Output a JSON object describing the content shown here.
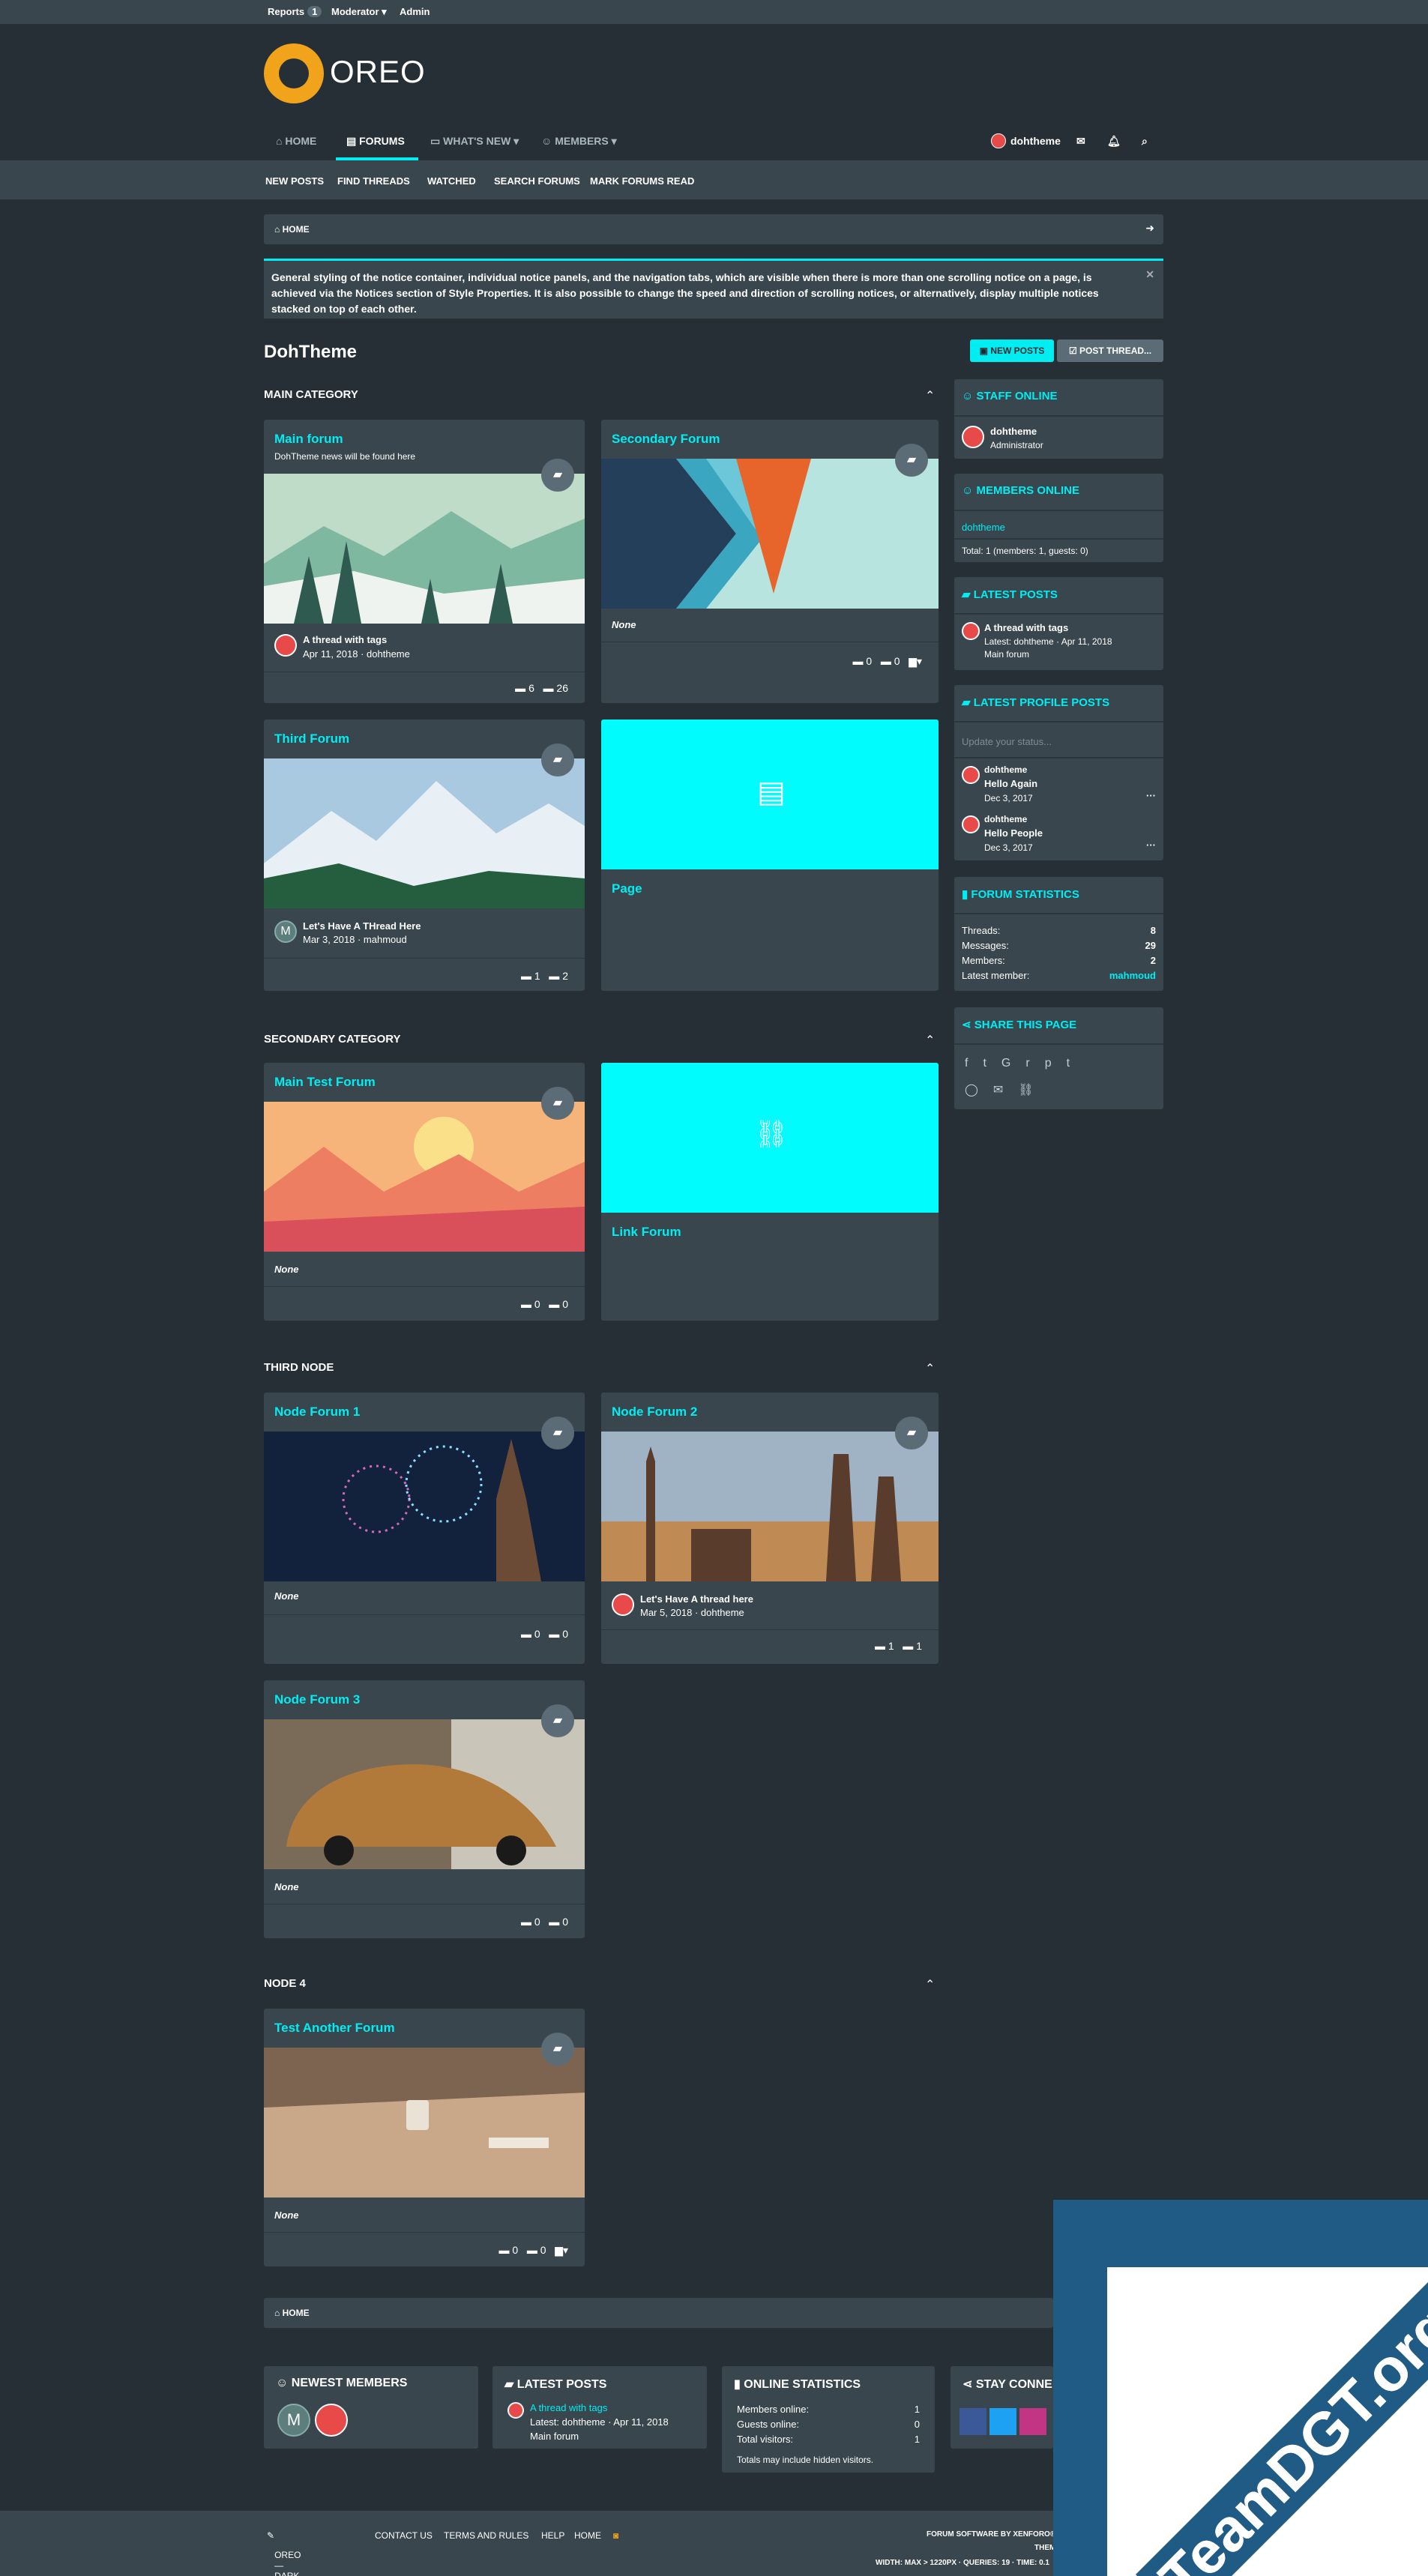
{
  "topbar": {
    "reports": "Reports",
    "reports_count": "1",
    "moderator": "Moderator ▾",
    "admin": "Admin"
  },
  "logo_text": "OREO",
  "nav": {
    "home": "HOME",
    "forums": "FORUMS",
    "whats_new": "WHAT'S NEW",
    "members": "MEMBERS",
    "user": "dohtheme"
  },
  "subnav": {
    "new_posts": "NEW POSTS",
    "find_threads": "FIND THREADS",
    "watched": "WATCHED",
    "search_forums": "SEARCH FORUMS",
    "mark_read": "MARK FORUMS READ"
  },
  "breadcrumb": "HOME",
  "notice": "General styling of the notice container, individual notice panels, and the navigation tabs, which are visible when there is more than one scrolling notice on a page, is achieved via the Notices section of Style Properties. It is also possible to change the speed and direction of scrolling notices, or alternatively, display multiple notices stacked on top of each other.",
  "page_title": "DohTheme",
  "buttons": {
    "new_posts": "NEW POSTS",
    "post_thread": "POST THREAD..."
  },
  "categories": {
    "main": "MAIN CATEGORY",
    "secondary": "SECONDARY CATEGORY",
    "third": "THIRD NODE",
    "node4": "NODE 4"
  },
  "forums": {
    "main_forum": {
      "title": "Main forum",
      "desc": "DohTheme news will be found here",
      "thread": "A thread with tags",
      "meta": "Apr 11, 2018 · dohtheme",
      "threads": "6",
      "messages": "26"
    },
    "secondary_forum": {
      "title": "Secondary Forum",
      "none": "None",
      "threads": "0",
      "messages": "0"
    },
    "third_forum": {
      "title": "Third Forum",
      "thread": "Let's Have A THread Here",
      "meta": "Mar 3, 2018 · mahmoud",
      "threads": "1",
      "messages": "2"
    },
    "page": {
      "title": "Page"
    },
    "main_test": {
      "title": "Main Test Forum",
      "none": "None",
      "threads": "0",
      "messages": "0"
    },
    "link_forum": {
      "title": "Link Forum"
    },
    "node1": {
      "title": "Node Forum 1",
      "none": "None",
      "threads": "0",
      "messages": "0"
    },
    "node2": {
      "title": "Node Forum 2",
      "thread": "Let's Have A thread here",
      "meta": "Mar 5, 2018 · dohtheme",
      "threads": "1",
      "messages": "1"
    },
    "node3": {
      "title": "Node Forum 3",
      "none": "None",
      "threads": "0",
      "messages": "0"
    },
    "another": {
      "title": "Test Another Forum",
      "none": "None",
      "threads": "0",
      "messages": "0"
    }
  },
  "sidebar": {
    "staff": {
      "title": "STAFF ONLINE",
      "name": "dohtheme",
      "role": "Administrator"
    },
    "members": {
      "title": "MEMBERS ONLINE",
      "name": "dohtheme",
      "total": "Total: 1 (members: 1, guests: 0)"
    },
    "latest": {
      "title": "LATEST POSTS",
      "thread": "A thread with tags",
      "meta": "Latest: dohtheme · Apr 11, 2018",
      "forum": "Main forum"
    },
    "profile": {
      "title": "LATEST PROFILE POSTS",
      "placeholder": "Update your status...",
      "p1_user": "dohtheme",
      "p1_msg": "Hello Again",
      "p1_date": "Dec 3, 2017",
      "p2_user": "dohtheme",
      "p2_msg": "Hello People",
      "p2_date": "Dec 3, 2017",
      "more": "···"
    },
    "stats": {
      "title": "FORUM STATISTICS",
      "threads_l": "Threads:",
      "threads_v": "8",
      "messages_l": "Messages:",
      "messages_v": "29",
      "members_l": "Members:",
      "members_v": "2",
      "latest_l": "Latest member:",
      "latest_v": "mahmoud"
    },
    "share": {
      "title": "SHARE THIS PAGE"
    }
  },
  "footer_blocks": {
    "newest": "NEWEST MEMBERS",
    "latest": "LATEST POSTS",
    "latest_thread": "A thread with tags",
    "latest_meta": "Latest: dohtheme · Apr 11, 2018",
    "latest_forum": "Main forum",
    "online": "ONLINE STATISTICS",
    "members_online": "Members online:",
    "members_online_v": "1",
    "guests_online": "Guests online:",
    "guests_online_v": "0",
    "total_visitors": "Total visitors:",
    "total_visitors_v": "1",
    "hidden": "Totals may include hidden visitors.",
    "stay": "STAY CONNE"
  },
  "footer": {
    "style": "OREO—DARK—CYAN",
    "contact": "CONTACT US",
    "terms": "TERMS AND RULES",
    "help": "HELP",
    "home": "HOME",
    "software": "FORUM SOFTWARE BY XENFORO®",
    "theme": "THEM",
    "width": "WIDTH: MAX > 1220PX · QUERIES: 19 · TIME: 0.1"
  },
  "watermark": "TeamDGT.org",
  "avatar_m": "M"
}
